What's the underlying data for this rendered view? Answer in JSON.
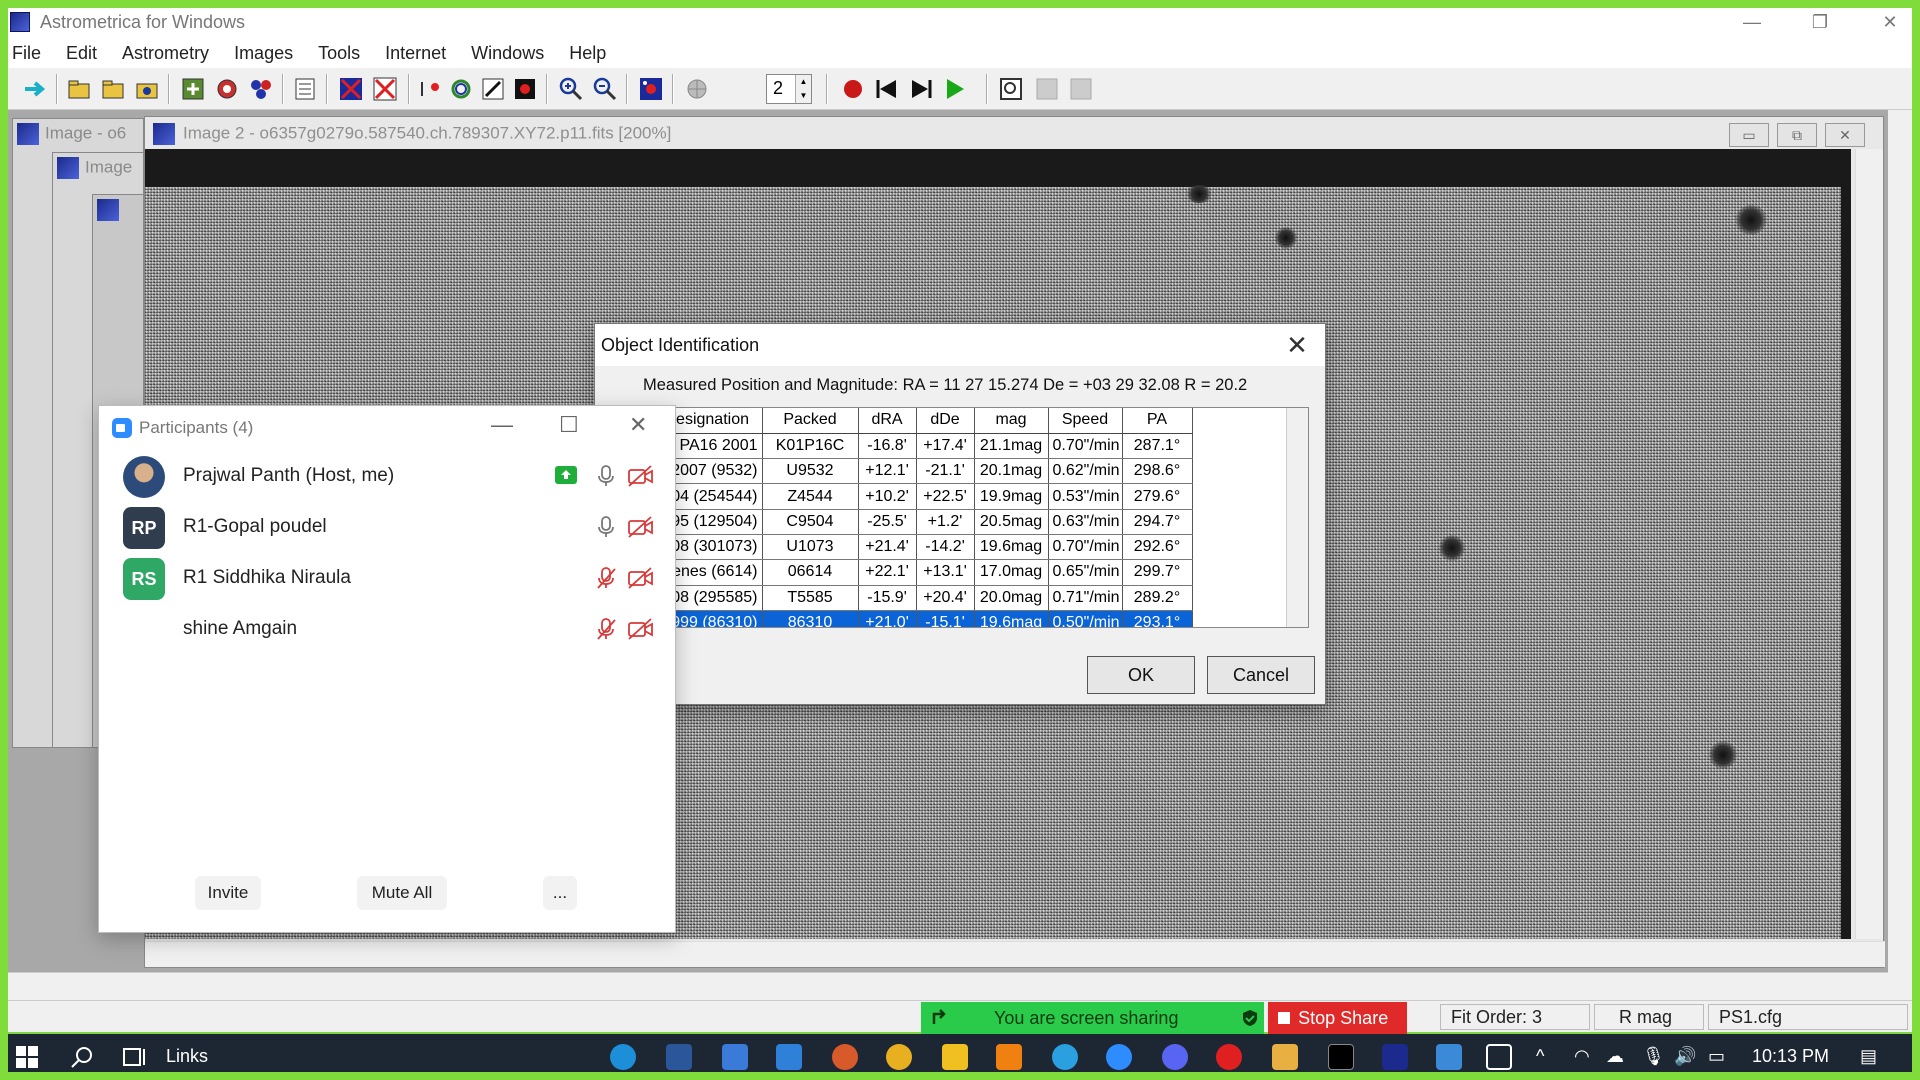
{
  "app": {
    "title": "Astrometrica for Windows",
    "window_controls": {
      "minimize": "—",
      "restore": "❐",
      "close": "✕"
    }
  },
  "menu": [
    "File",
    "Edit",
    "Astrometry",
    "Images",
    "Tools",
    "Internet",
    "Windows",
    "Help"
  ],
  "toolbar": {
    "spin_value": "2"
  },
  "mdi": {
    "bg_window_1_title": "Image - o6",
    "bg_window_2_title": "Image",
    "image_window_title": "Image 2 - o6357g0279o.587540.ch.789307.XY72.p11.fits [200%]"
  },
  "dialog": {
    "title": "Object Identification",
    "measured": "Measured Position and Magnitude: RA = 11 27 15.274   De = +03 29 32.08   R = 20.2",
    "columns": [
      "Designation",
      "Packed",
      "dRA",
      "dDe",
      "mag",
      "Speed",
      "PA"
    ],
    "rows": [
      [
        "2001 PA16",
        "K01P16C",
        "-16.8'",
        "+17.4'",
        "21.1mag",
        "0.70\"/min",
        "287.1°"
      ],
      [
        "(9532) 2007 XO46",
        "U9532",
        "+12.1'",
        "-21.1'",
        "20.1mag",
        "0.62\"/min",
        "298.6°"
      ],
      [
        "(254544) 2004 RY294",
        "Z4544",
        "+10.2'",
        "+22.5'",
        "19.9mag",
        "0.53\"/min",
        "279.6°"
      ],
      [
        "(129504) 1995 SU8",
        "C9504",
        "-25.5'",
        "+1.2'",
        "20.5mag",
        "0.63\"/min",
        "294.7°"
      ],
      [
        "(301073) 2008 UU200",
        "U1073",
        "+21.4'",
        "-14.2'",
        "19.6mag",
        "0.70\"/min",
        "292.6°"
      ],
      [
        "(6614) Antisthenes",
        "06614",
        "+22.1'",
        "+13.1'",
        "17.0mag",
        "0.65\"/min",
        "299.7°"
      ],
      [
        "(295585) 2008 SS124",
        "T5585",
        "-15.9'",
        "+20.4'",
        "20.0mag",
        "0.71\"/min",
        "289.2°"
      ],
      [
        "(86310) 1999 VK96",
        "86310",
        "+21.0'",
        "-15.1'",
        "19.6mag",
        "0.50\"/min",
        "293.1°"
      ]
    ],
    "selected_row": 7,
    "ok_label": "OK",
    "cancel_label": "Cancel",
    "close_label": "✕"
  },
  "participants": {
    "title": "Participants (4)",
    "list": [
      {
        "initials": "",
        "name": "Prajwal Panth (Host, me)",
        "color": "#2c4a7a",
        "muted": false,
        "sharing": true
      },
      {
        "initials": "RP",
        "name": "R1-Gopal poudel",
        "color": "#2f3d4f",
        "muted": false,
        "sharing": false
      },
      {
        "initials": "RS",
        "name": "R1 Siddhika Niraula",
        "color": "#2fa866",
        "muted": true,
        "sharing": false
      },
      {
        "initials": "",
        "name": "shine Amgain",
        "color": "#ffffff",
        "muted": true,
        "sharing": false
      }
    ],
    "invite_label": "Invite",
    "mute_all_label": "Mute All",
    "more_label": "...",
    "minimize": "—",
    "maximize": "☐",
    "close": "✕"
  },
  "share": {
    "text": "You are screen sharing",
    "stop_label": "Stop Share"
  },
  "statusbar": {
    "fit_order": "Fit Order: 3",
    "band": "R mag",
    "config": "PS1.cfg"
  },
  "taskbar": {
    "links_label": "Links",
    "time": "10:13 PM"
  },
  "colors": {
    "share_border": "#7fdc3b",
    "selection": "#0a64d8",
    "stop_share": "#e02a2a",
    "sharing_green": "#2aca4a"
  }
}
